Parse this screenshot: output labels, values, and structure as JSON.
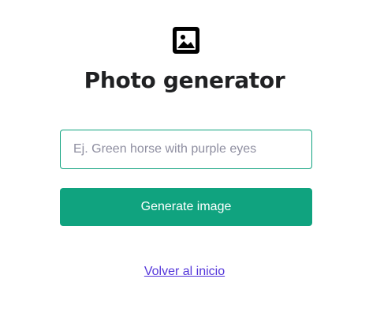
{
  "header": {
    "logo_icon": "image-icon",
    "title": "Photo generator"
  },
  "form": {
    "prompt_placeholder": "Ej. Green horse with purple eyes",
    "prompt_value": "",
    "generate_label": "Generate image"
  },
  "footer": {
    "back_link_label": "Volver al inicio"
  },
  "colors": {
    "accent": "#10a37f",
    "title_text": "#202123",
    "placeholder_text": "#8e8ea0",
    "link": "#5436da",
    "background": "#ffffff"
  }
}
